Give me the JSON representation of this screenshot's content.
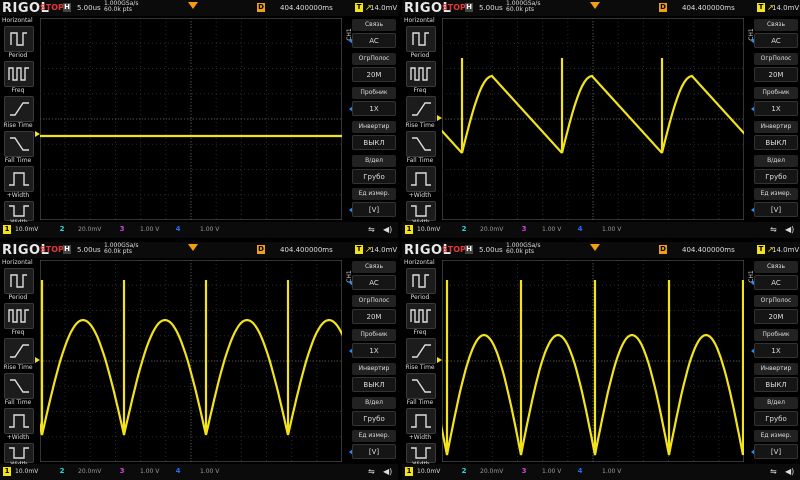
{
  "common": {
    "brand": "RIGOL",
    "status": "STOP",
    "horizontal_box": "H",
    "timebase": "5.00us",
    "sample_rate_line1": "1.000GSa/s",
    "sample_rate_line2": "60.0k pts",
    "delay_box": "D",
    "delay_value": "404.400000ms",
    "trigger_box": "T",
    "trigger_slope_icon": "rising-edge-icon",
    "trigger_level": "14.0mV",
    "left_menu": {
      "title": "Horizontal",
      "items": [
        "Period",
        "Freq",
        "Rise Time",
        "Fall Time",
        "+Width",
        "-Width"
      ]
    },
    "right_menu": {
      "channel": "CH1",
      "items": [
        {
          "title": "Связь",
          "value": "AC"
        },
        {
          "title": "ОгрПолос",
          "value": "20M"
        },
        {
          "title": "Пробник",
          "value": "1X"
        },
        {
          "title": "Инвертир",
          "value": "ВЫКЛ"
        },
        {
          "title": "В/дел",
          "value": "Грубо"
        },
        {
          "title": "Ед измер.",
          "value": "[V]"
        }
      ]
    },
    "channels": [
      {
        "num": "1",
        "value": "10.0mV",
        "color": "#f2e31a"
      },
      {
        "num": "2",
        "value": "20.0mV",
        "color": "#28d8e0"
      },
      {
        "num": "3",
        "value": "1.00 V",
        "color": "#d044d0"
      },
      {
        "num": "4",
        "value": "1.00 V",
        "color": "#2a6cf0"
      }
    ],
    "trace_color": "#f2e31a",
    "accent_blue": "#1e90ff"
  },
  "panels": [
    "top-left",
    "top-right",
    "bottom-left",
    "bottom-right"
  ]
}
